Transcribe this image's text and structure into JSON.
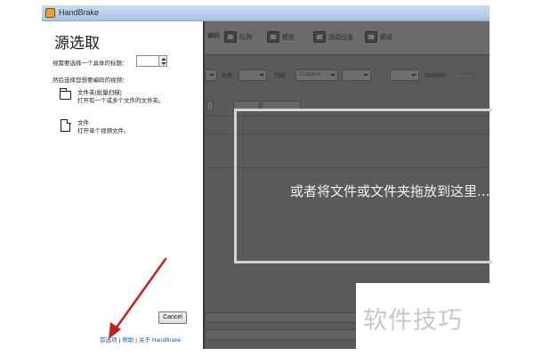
{
  "window": {
    "title": "HandBrake"
  },
  "panel": {
    "title": "源选取",
    "title_prompt": "视需要选择一个具体的标题：",
    "then_select": "然后选择您想要编码的视频：",
    "folder_option": {
      "title": "文件夹(批量扫描)",
      "desc": "打开有一个或多个文件的文件夹。"
    },
    "file_option": {
      "title": "文件",
      "desc": "打开单个视频文件。"
    },
    "cancel": "Cancel",
    "links": {
      "preferences": "首选项",
      "sep": "|",
      "help": "帮助",
      "about": "关于 HandBrake"
    }
  },
  "toolbar": {
    "items": [
      {
        "label": "编码",
        "icon": "encode-icon"
      },
      {
        "label": "队列",
        "icon": "queue-icon"
      },
      {
        "label": "预览",
        "icon": "preview-icon"
      },
      {
        "label": "活动日志",
        "icon": "activity-log-icon"
      },
      {
        "label": "预设",
        "icon": "presets-icon"
      }
    ]
  },
  "options_row": {
    "angle_label": "角度",
    "range_label": "范围：",
    "range_value": "Chapters",
    "dash": "-",
    "duration_label": "持续时间：",
    "duration_value": "--:--:--"
  },
  "drop_zone": {
    "text": "或者将文件或文件夹拖放到这里..."
  },
  "watermark": "软件技巧",
  "colors": {
    "annotation": "#c0231f",
    "link": "#1a5fb4"
  }
}
